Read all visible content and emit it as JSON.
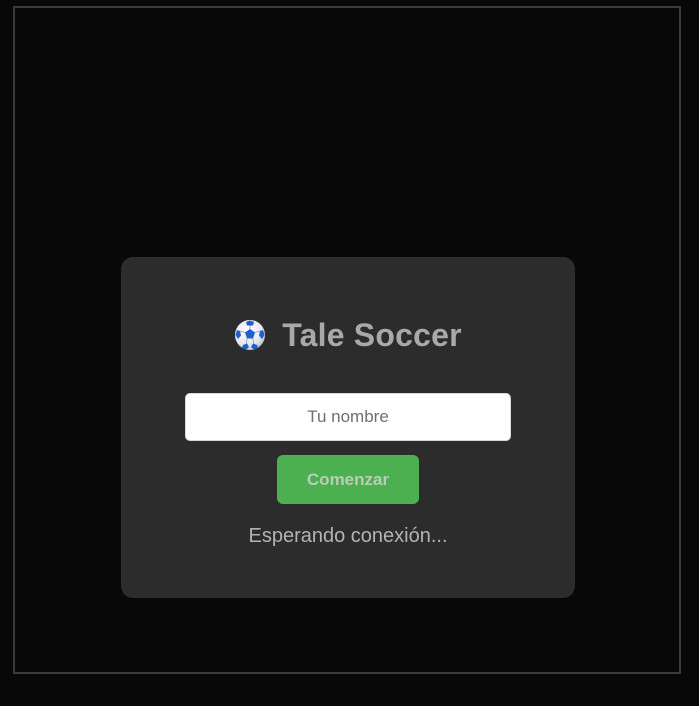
{
  "game": {
    "title": "Tale Soccer",
    "logo_icon": "soccer-ball-icon"
  },
  "login": {
    "name_placeholder": "Tu nombre",
    "name_value": "",
    "start_label": "Comenzar",
    "status_text": "Esperando conexión..."
  },
  "colors": {
    "background": "#080808",
    "panel": "#2c2c2c",
    "start_button": "#4caf50",
    "ball_accent": "#1565c0"
  }
}
